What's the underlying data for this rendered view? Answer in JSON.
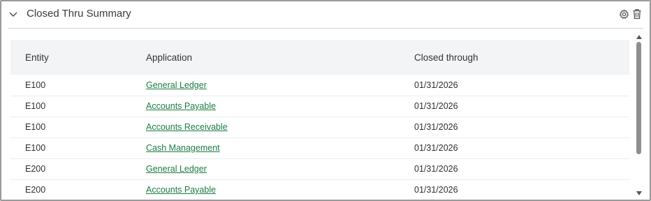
{
  "panel": {
    "title": "Closed Thru Summary",
    "icons": {
      "collapse": "chevron-down-icon",
      "settings": "gear-icon",
      "delete": "trash-icon"
    }
  },
  "table": {
    "columns": [
      "Entity",
      "Application",
      "Closed through"
    ],
    "rows": [
      {
        "entity": "E100",
        "application": "General Ledger",
        "closed_through": "01/31/2026"
      },
      {
        "entity": "E100",
        "application": "Accounts Payable",
        "closed_through": "01/31/2026"
      },
      {
        "entity": "E100",
        "application": "Accounts Receivable",
        "closed_through": "01/31/2026"
      },
      {
        "entity": "E100",
        "application": "Cash Management",
        "closed_through": "01/31/2026"
      },
      {
        "entity": "E200",
        "application": "General Ledger",
        "closed_through": "01/31/2026"
      },
      {
        "entity": "E200",
        "application": "Accounts Payable",
        "closed_through": "01/31/2026"
      }
    ]
  },
  "colors": {
    "link": "#1b7c42",
    "header_bg": "#f2f4f5",
    "scroll_thumb": "#8f8f8f"
  }
}
